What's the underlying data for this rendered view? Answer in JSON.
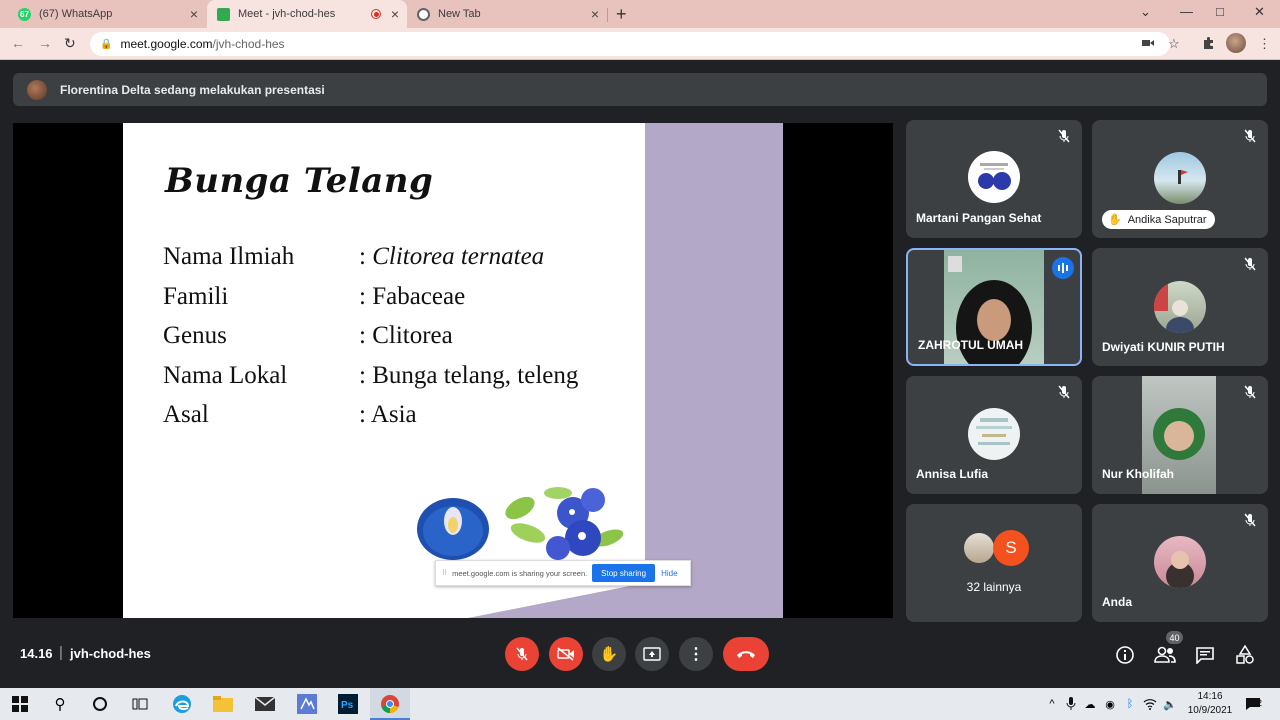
{
  "browser": {
    "tabs": [
      {
        "label": "(67) WhatsApp",
        "favicon_text": "67",
        "favicon_color": "#25d366"
      },
      {
        "label": "Meet - jvh-chod-hes",
        "favicon_text": "",
        "favicon_color": "#34a853",
        "recording": true
      },
      {
        "label": "New Tab",
        "favicon_text": "",
        "favicon_color": "#5f6368"
      }
    ],
    "new_tab_glyph": "+",
    "url_host": "meet.google.com",
    "url_path": "/jvh-chod-hes"
  },
  "meet": {
    "presenter_banner": "Florentina Delta sedang melakukan presentasi",
    "slide": {
      "title": "Bunga Telang",
      "rows": [
        {
          "key": "Nama Ilmiah",
          "value": ": ",
          "value_italic": "Clitorea ternatea"
        },
        {
          "key": "Famili",
          "value": ": Fabaceae",
          "value_italic": ""
        },
        {
          "key": "Genus",
          "value": ": Clitorea",
          "value_italic": ""
        },
        {
          "key": "Nama Lokal",
          "value": ": Bunga telang, teleng",
          "value_italic": ""
        },
        {
          "key": "Asal",
          "value": ": Asia",
          "value_italic": ""
        }
      ]
    },
    "share_notice": {
      "grip": "⠿",
      "message": "meet.google.com is sharing your screen.",
      "stop_label": "Stop sharing",
      "hide_label": "Hide"
    },
    "participants": [
      {
        "name": "Martani Pangan Sehat"
      },
      {
        "name": "Andika Saputrar"
      },
      {
        "name": "ZAHROTUL UMAH"
      },
      {
        "name": "Dwiyati KUNIR PUTIH"
      },
      {
        "name": "Annisa Lufia"
      },
      {
        "name": "Nur Kholifah"
      },
      {
        "name": "32 lainnya",
        "others_initial": "S"
      },
      {
        "name": "Anda"
      }
    ],
    "bottom": {
      "time": "14.16",
      "separator": "|",
      "code": "jvh-chod-hes",
      "people_count": "40"
    }
  },
  "taskbar": {
    "time": "14:16",
    "date": "10/9/2021",
    "notifications": "12"
  },
  "colors": {
    "meet_bg": "#202124",
    "tile_bg": "#3c4043",
    "danger": "#ea4335",
    "accent": "#1a73e8",
    "chrome_tab": "#e8c3bd"
  }
}
